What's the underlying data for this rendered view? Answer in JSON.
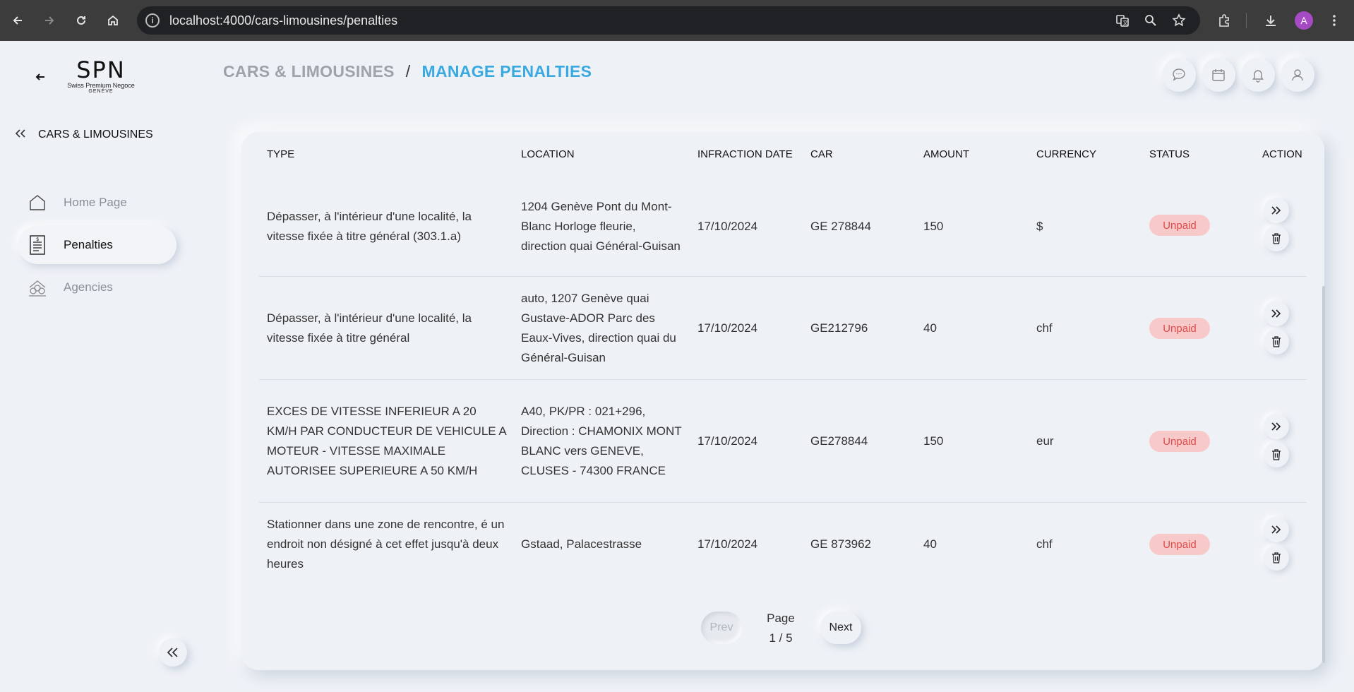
{
  "browser": {
    "url": "localhost:4000/cars-limousines/penalties",
    "profile_initial": "A"
  },
  "sidebar": {
    "logo_text": "SPN",
    "logo_subtitle": "Swiss Premium Negoce",
    "logo_city": "GENÈVE",
    "section_label": "CARS & LIMOUSINES",
    "items": [
      {
        "label": "Home Page",
        "icon": "home-icon",
        "active": false
      },
      {
        "label": "Penalties",
        "icon": "document-icon",
        "active": true
      },
      {
        "label": "Agencies",
        "icon": "building-icon",
        "active": false
      }
    ]
  },
  "header": {
    "breadcrumb_parent": "CARS & LIMOUSINES",
    "breadcrumb_separator": "/",
    "breadcrumb_current": "MANAGE PENALTIES",
    "icons": [
      "chat-icon",
      "calendar-icon",
      "bell-icon",
      "user-icon"
    ]
  },
  "table": {
    "columns": [
      "TYPE",
      "LOCATION",
      "INFRACTION DATE",
      "CAR",
      "AMOUNT",
      "CURRENCY",
      "STATUS",
      "ACTION"
    ],
    "rows": [
      {
        "type": "Dépasser, à l'intérieur d'une localité, la vitesse fixée à titre général (303.1.a)",
        "location": "1204 Genève Pont du Mont-Blanc Horloge fleurie, direction quai Général-Guisan",
        "date": "17/10/2024",
        "car": "GE 278844",
        "amount": "150",
        "currency": "$",
        "status": "Unpaid"
      },
      {
        "type": "Dépasser, à l'intérieur d'une localité, la vitesse fixée à titre général",
        "location": "auto, 1207 Genève quai Gustave-ADOR Parc des Eaux-Vives, direction quai du Général-Guisan",
        "date": "17/10/2024",
        "car": "GE212796",
        "amount": "40",
        "currency": "chf",
        "status": "Unpaid"
      },
      {
        "type": "EXCES DE VITESSE INFERIEUR A 20 KM/H PAR CONDUCTEUR DE VEHICULE A MOTEUR - VITESSE MAXIMALE AUTORISEE SUPERIEURE A 50 KM/H",
        "location": "A40, PK/PR : 021+296, Direction : CHAMONIX MONT BLANC vers GENEVE, CLUSES - 74300 FRANCE",
        "date": "17/10/2024",
        "car": "GE278844",
        "amount": "150",
        "currency": "eur",
        "status": "Unpaid"
      },
      {
        "type": "Stationner dans une zone de rencontre, é un endroit non désigné à cet effet jusqu'à deux heures",
        "location": "Gstaad, Palacestrasse",
        "date": "17/10/2024",
        "car": "GE 873962",
        "amount": "40",
        "currency": "chf",
        "status": "Unpaid"
      }
    ]
  },
  "pagination": {
    "prev_label": "Prev",
    "next_label": "Next",
    "page_label": "Page",
    "page_info": "1 / 5"
  },
  "colors": {
    "accent": "#3aa9df",
    "status_unpaid_bg": "#f8c9c9",
    "status_unpaid_text": "#e04b4b",
    "background": "#eef1f6"
  }
}
